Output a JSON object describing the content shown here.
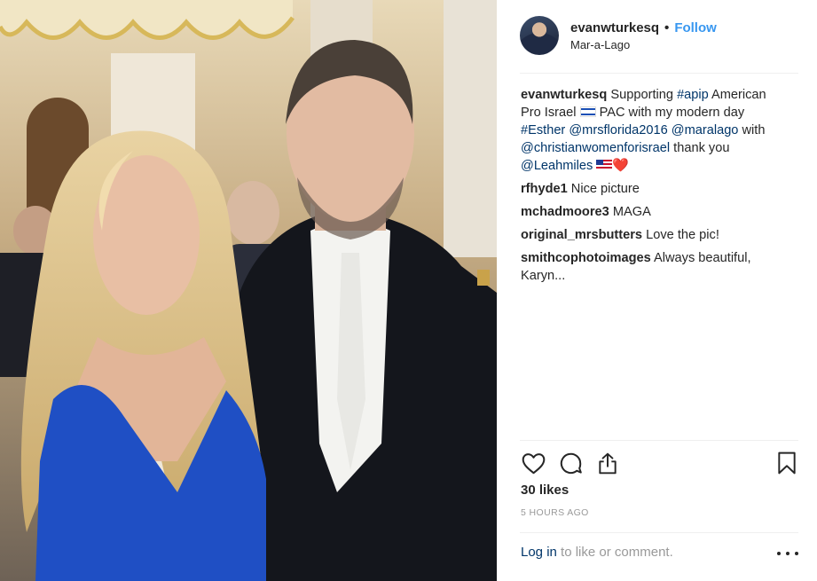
{
  "post": {
    "username": "evanwturkesq",
    "separator": "•",
    "follow_label": "Follow",
    "location": "Mar-a-Lago"
  },
  "caption": {
    "username": "evanwturkesq",
    "text_1": "Supporting ",
    "tag_apip": "#apip",
    "text_2": " American Pro Israel ",
    "text_3": " PAC with my modern day ",
    "tag_esther": "#Esther",
    "mention_mrsflorida": "@mrsflorida2016",
    "mention_maralago": "@maralago",
    "text_with": " with ",
    "mention_cwfi": "@christianwomenforisrael",
    "text_thanks": " thank you ",
    "mention_leah": "@Leahmiles",
    "heart": "❤️"
  },
  "comments": [
    {
      "user": "rfhyde1",
      "text": "Nice picture"
    },
    {
      "user": "mchadmoore3",
      "text": "MAGA"
    },
    {
      "user": "original_mrsbutters",
      "text": "Love the pic!"
    },
    {
      "user": "smithcophotoimages",
      "text": "Always beautiful, Karyn..."
    }
  ],
  "likes": "30 likes",
  "time_ago": "5 HOURS AGO",
  "login": {
    "link": "Log in",
    "rest": " to like or comment."
  },
  "icons": {
    "like": "heart-outline-icon",
    "comment": "speech-bubble-icon",
    "share": "share-upload-icon",
    "save": "bookmark-icon",
    "more": "more-dots-icon"
  },
  "colors": {
    "link_blue": "#3897f0",
    "mention_blue": "#003569",
    "muted": "#999999",
    "text": "#262626"
  }
}
